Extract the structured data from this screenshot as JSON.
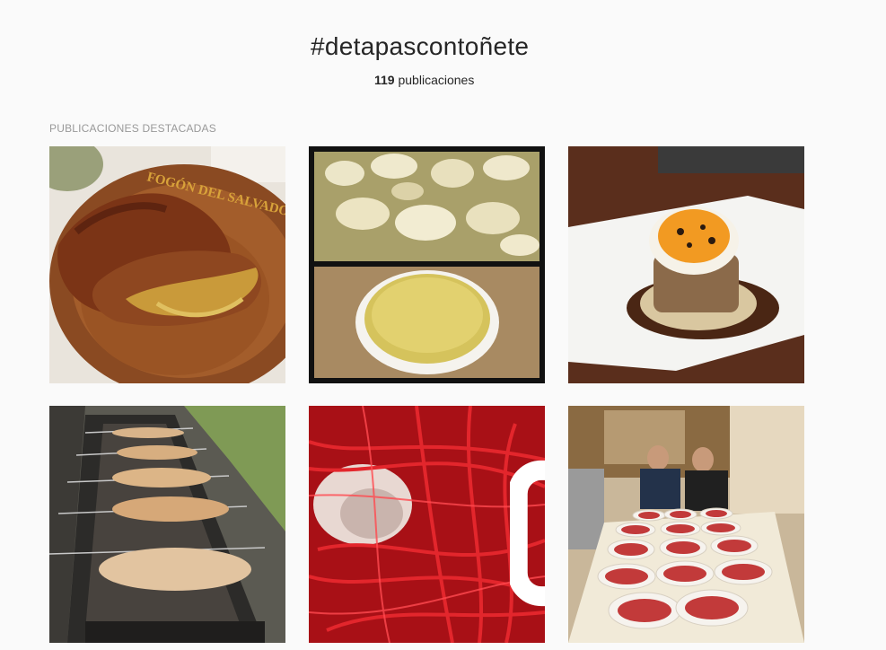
{
  "header": {
    "hashtag": "#detapascontoñete",
    "post_count": "119",
    "post_count_label": "publicaciones"
  },
  "featured": {
    "section_label": "PUBLICACIONES DESTACADAS",
    "posts": [
      {
        "name": "post-roast-suckling-pig-plate",
        "plate_text": "FOGÓN DEL SALVADOR"
      },
      {
        "name": "post-spanish-omelette-collage"
      },
      {
        "name": "post-egg-tower-dish"
      },
      {
        "name": "post-lambs-roasting-on-spits"
      },
      {
        "name": "post-red-licorice-video",
        "media_type": "video",
        "icon": "video-camera-icon"
      },
      {
        "name": "post-jamon-plates-table"
      }
    ]
  }
}
